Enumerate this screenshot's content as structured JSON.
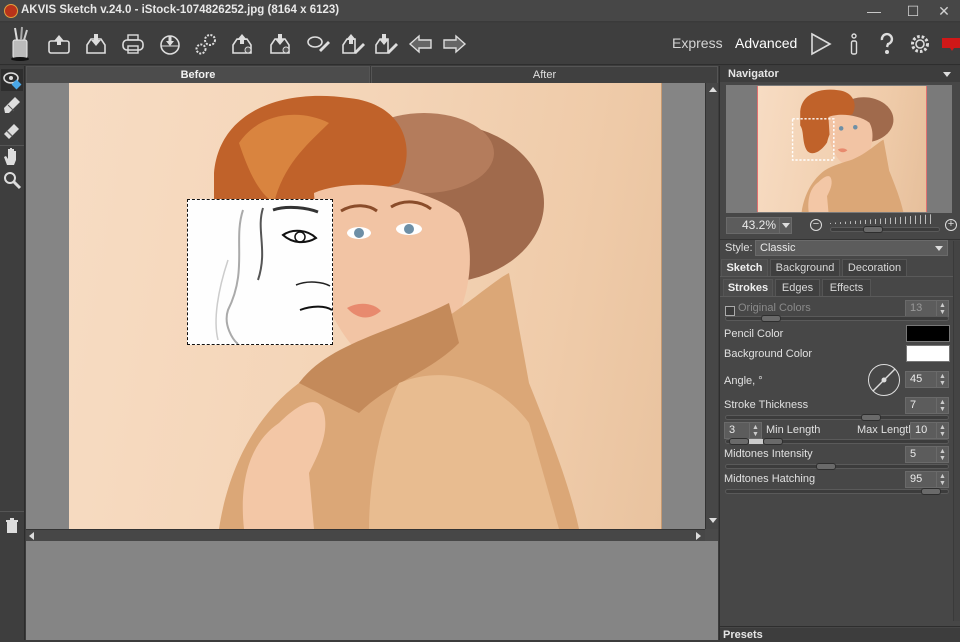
{
  "window": {
    "title": "AKVIS Sketch v.24.0 - iStock-1074826252.jpg (8164 x 6123)",
    "controls": {
      "minimize": "—",
      "maximize": "☐",
      "close": "✕"
    }
  },
  "toolbar": {
    "icons": [
      "sketch-logo-icon",
      "open-file-icon",
      "save-file-icon",
      "print-icon",
      "share-icon",
      "batch-processing-icon",
      "load-settings-icon",
      "save-settings-icon",
      "comment-icon",
      "import-strokes-icon",
      "export-strokes-icon",
      "undo-icon",
      "redo-icon"
    ],
    "modes": {
      "express": "Express",
      "advanced": "Advanced"
    },
    "right_icons": [
      "run-icon",
      "info-icon",
      "help-icon",
      "preferences-icon",
      "news-icon"
    ]
  },
  "left_tools": [
    "sketch-preview-tool-icon",
    "pencil-tool-icon",
    "eraser-tool-icon",
    "hand-tool-icon",
    "zoom-tool-icon",
    "trash-icon"
  ],
  "view_tabs": {
    "before": "Before",
    "after": "After",
    "active": "before"
  },
  "navigator": {
    "title": "Navigator",
    "zoom_value": "43.2%"
  },
  "style": {
    "label": "Style:",
    "value": "Classic"
  },
  "tabs": [
    "Sketch",
    "Background",
    "Decoration"
  ],
  "subtabs": [
    "Strokes",
    "Edges",
    "Effects"
  ],
  "params": {
    "original_colors": {
      "label": "Original Colors",
      "checked": false,
      "value": "13"
    },
    "pencil_color": {
      "label": "Pencil Color",
      "color": "#000000"
    },
    "background_color": {
      "label": "Background Color",
      "color": "#ffffff"
    },
    "angle": {
      "label": "Angle, °",
      "value": "45"
    },
    "stroke_thickness": {
      "label": "Stroke Thickness",
      "value": "7"
    },
    "min_length": {
      "label": "Min Length",
      "value": "3"
    },
    "max_length": {
      "label": "Max Length",
      "value": "10"
    },
    "midtones_intensity": {
      "label": "Midtones Intensity",
      "value": "5"
    },
    "midtones_hatching": {
      "label": "Midtones Hatching",
      "value": "95"
    }
  },
  "presets": {
    "title": "Presets"
  }
}
